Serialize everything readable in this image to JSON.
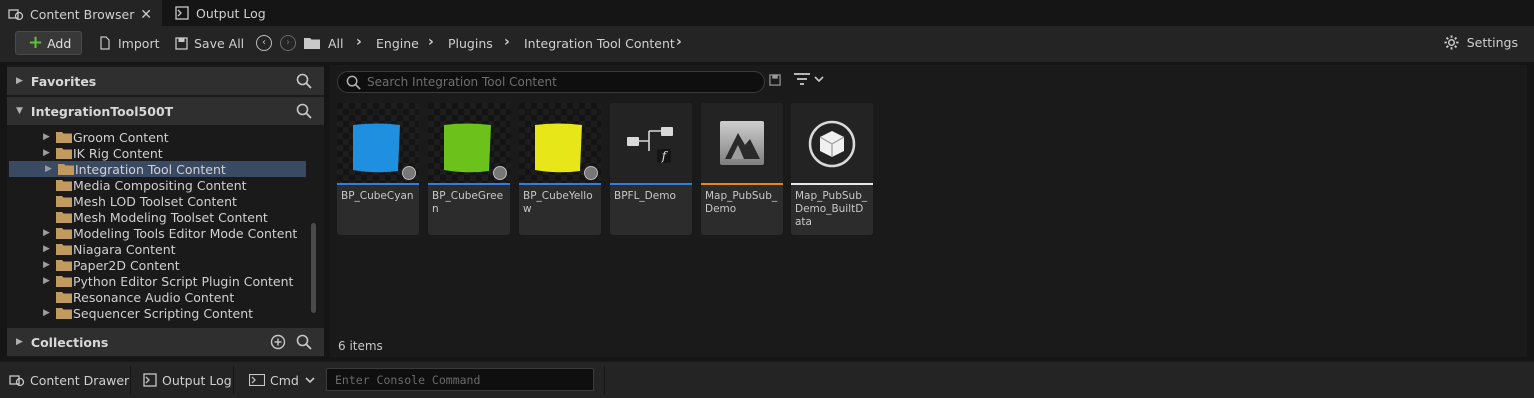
{
  "tabs": [
    {
      "label": "Content Browser",
      "icon": "content-browser-icon"
    },
    {
      "label": "Output Log",
      "icon": "output-log-icon"
    }
  ],
  "toolbar": {
    "add_label": "Add",
    "import_label": "Import",
    "save_all_label": "Save All",
    "settings_label": "Settings"
  },
  "breadcrumb": [
    "All",
    "Engine",
    "Plugins",
    "Integration Tool Content"
  ],
  "sidebar": {
    "favorites_label": "Favorites",
    "project_label": "IntegrationTool500T",
    "collections_label": "Collections",
    "tree": [
      {
        "label": "Groom Content",
        "expandable": true,
        "selected": false
      },
      {
        "label": "IK Rig Content",
        "expandable": true,
        "selected": false
      },
      {
        "label": "Integration Tool Content",
        "expandable": true,
        "selected": true
      },
      {
        "label": "Media Compositing Content",
        "expandable": false,
        "selected": false
      },
      {
        "label": "Mesh LOD Toolset Content",
        "expandable": false,
        "selected": false
      },
      {
        "label": "Mesh Modeling Toolset Content",
        "expandable": false,
        "selected": false
      },
      {
        "label": "Modeling Tools Editor Mode Content",
        "expandable": true,
        "selected": false
      },
      {
        "label": "Niagara Content",
        "expandable": true,
        "selected": false
      },
      {
        "label": "Paper2D Content",
        "expandable": true,
        "selected": false
      },
      {
        "label": "Python Editor Script Plugin Content",
        "expandable": true,
        "selected": false
      },
      {
        "label": "Resonance Audio Content",
        "expandable": false,
        "selected": false
      },
      {
        "label": "Sequencer Scripting Content",
        "expandable": true,
        "selected": false
      }
    ]
  },
  "search": {
    "placeholder": "Search Integration Tool Content"
  },
  "assets": [
    {
      "name": "BP_CubeCyan",
      "kind": "blueprint",
      "color": "#1f8fe0",
      "strip": "#3a7bd5"
    },
    {
      "name": "BP_CubeGreen",
      "kind": "blueprint",
      "color": "#6cc21a",
      "strip": "#3a7bd5"
    },
    {
      "name": "BP_CubeYellow",
      "kind": "blueprint",
      "color": "#e6e619",
      "strip": "#3a7bd5"
    },
    {
      "name": "BPFL_Demo",
      "kind": "function-library",
      "color": "",
      "strip": "#3a7bd5"
    },
    {
      "name": "Map_PubSub_Demo",
      "kind": "level",
      "color": "",
      "strip": "#e08a1e"
    },
    {
      "name": "Map_PubSub_Demo_BuiltData",
      "kind": "built-data",
      "color": "",
      "strip": "#e8e8e8"
    }
  ],
  "item_count": "6 items",
  "statusbar": {
    "content_drawer_label": "Content Drawer",
    "output_log_label": "Output Log",
    "cmd_label": "Cmd",
    "console_placeholder": "Enter Console Command"
  }
}
